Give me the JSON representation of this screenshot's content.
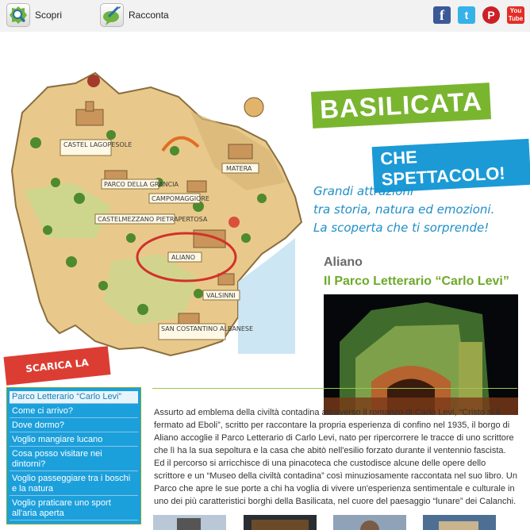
{
  "topbar": {
    "discover_label": "Scopri",
    "tell_label": "Racconta",
    "social": [
      {
        "name": "facebook",
        "glyph": "f",
        "color": "#3b5998"
      },
      {
        "name": "twitter",
        "glyph": "t",
        "color": "#36b2e8"
      },
      {
        "name": "pinterest",
        "glyph": "P",
        "color": "#cb2027"
      },
      {
        "name": "youtube",
        "glyph": "You Tube",
        "color": "#e52d27"
      }
    ]
  },
  "hero": {
    "brand_title": "BASILICATA",
    "brand_slogan": "CHE SPETTACOLO!",
    "tagline_1": "Grandi attrazioni",
    "tagline_2": "tra storia, natura ed emozioni.",
    "tagline_3": "La scoperta che ti sorprende!",
    "place": "Aliano",
    "place_subtitle": "Il Parco Letterario “Carlo Levi”",
    "download_label": "SCARICA LA BROCHURE",
    "map_labels": [
      "CASTEL LAGOPESOLE",
      "MATERA",
      "PARCO DELLA GRANCIA",
      "CAMPOMAGGIORE",
      "CASTELMEZZANO PIETRAPERTOSA",
      "ALIANO",
      "VALSINNI",
      "SAN COSTANTINO ALBANESE"
    ]
  },
  "sidebar": {
    "items": [
      {
        "label": "Parco Letterario “Carlo Levi”",
        "active": true
      },
      {
        "label": "Come ci arrivo?"
      },
      {
        "label": "Dove dormo?"
      },
      {
        "label": "Voglio mangiare lucano"
      },
      {
        "label": "Cosa posso visitare nei dintorni?"
      },
      {
        "label": "Voglio passeggiare tra i boschi e la natura"
      },
      {
        "label": "Voglio praticare uno sport all'aria aperta"
      }
    ]
  },
  "article": {
    "text": "Assurto ad emblema della civiltà contadina attraverso il romanzo di Carlo Levi, “Cristo si è fermato ad Eboli”, scritto per raccontare la propria esperienza di confino nel 1935, il borgo di Aliano accoglie il Parco Letterario di Carlo Levi, nato per ripercorrere le tracce di uno scrittore che lì ha la sua sepoltura e la casa che abitò nell'esilio forzato durante il ventennio fascista. Ed il percorso si arricchisce di una pinacoteca che custodisce alcune delle opere dello scrittore e un “Museo della civiltà contadina” così minuziosamente raccontata nel suo libro. Un Parco che apre le sue porte a chi ha voglia di vivere un'esperienza sentimentale e culturale in uno dei più caratteristici borghi della Basilicata, nel cuore del paesaggio “lunare” dei Calanchi."
  }
}
